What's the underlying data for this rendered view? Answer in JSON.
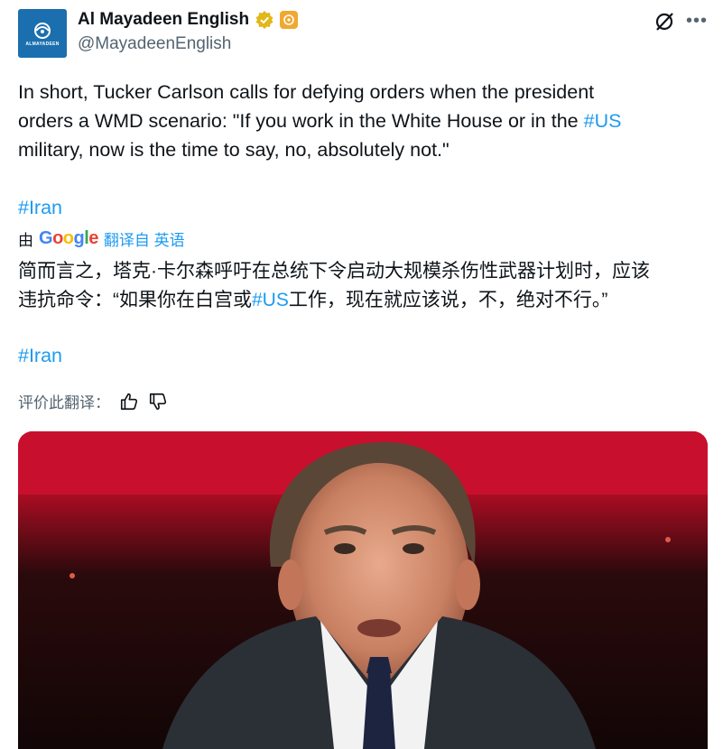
{
  "author": {
    "display_name": "Al Mayadeen English",
    "handle": "@MayadeenEnglish",
    "avatar_text": "ALMAYADEEN"
  },
  "tweet": {
    "lines": [
      "In short, Tucker Carlson calls for defying orders when the president",
      "orders a WMD scenario: \"If you work in the White House or in the ",
      "military, now is the time to say, no, absolutely not.\""
    ],
    "hashtag_us": "#US",
    "hashtag_iran": "#Iran"
  },
  "translation": {
    "by_label": "由",
    "google": [
      "G",
      "o",
      "o",
      "g",
      "l",
      "e"
    ],
    "translated_from": "翻译自 英语",
    "lines": [
      "简而言之，塔克·卡尔森呼吁在总统下令启动大规模杀伤性武器计划时，应该",
      "违抗命令：“如果你在白宫或",
      "工作，现在就应该说，不，绝对不行。”"
    ],
    "hashtag_us": "#US",
    "hashtag_iran": "#Iran",
    "rate_label": "评价此翻译："
  },
  "colors": {
    "link": "#1d9bf0",
    "avatar_bg": "#1b6fae",
    "photo_red": "#c8102e"
  },
  "icons": [
    "verified-badge-icon",
    "affiliate-badge-icon",
    "grok-icon",
    "more-icon",
    "thumbs-up-icon",
    "thumbs-down-icon"
  ]
}
